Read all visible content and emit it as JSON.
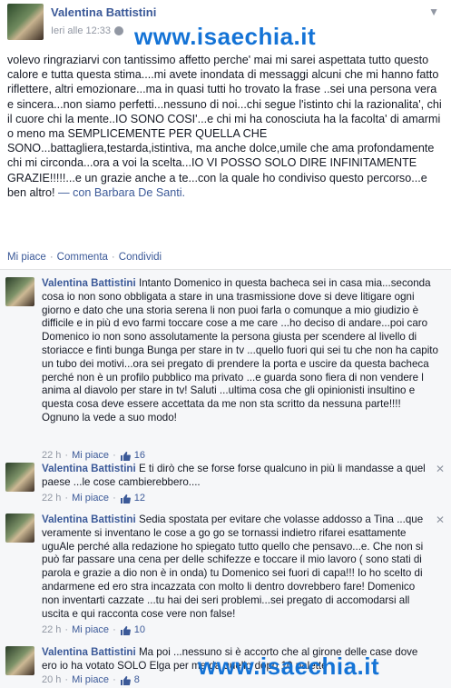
{
  "post": {
    "author": "Valentina Battistini",
    "timestamp": "Ieri alle 12:33",
    "body_main": "volevo ringraziarvi con tantissimo affetto perche' mai mi sarei aspettata tutto questo calore e tutta questa stima....mi avete inondata di messaggi alcuni che mi hanno fatto riflettere, altri emozionare...ma in quasi tutti ho trovato la frase ..sei una persona vera e sincera...non siamo perfetti...nessuno di noi...chi segue l'istinto chi la razionalita', chi il cuore chi la mente..IO SONO COSI'...e chi mi ha conosciuta ha la facolta' di amarmi o meno ma SEMPLICEMENTE PER QUELLA CHE SONO...battagliera,testarda,istintiva, ma anche dolce,umile che ama profondamente chi mi circonda...ora a voi la scelta...IO VI POSSO SOLO DIRE INFINITAMENTE GRAZIE!!!!!...e un grazie anche a te...con la quale ho condiviso questo percorso...e ben altro!",
    "body_with": "— con",
    "tagged": "Barbara De Santi.",
    "actions": {
      "like": "Mi piace",
      "comment": "Commenta",
      "share": "Condividi",
      "separator": "·"
    }
  },
  "watermark": "www.isaechia.it",
  "comments": [
    {
      "author": "Valentina Battistini",
      "text": "Intanto Domenico in questa bacheca sei in casa mia...seconda cosa io non sono obbligata a stare in una trasmissione dove si deve litigare ogni giorno e dato che una storia serena li non puoi farla o comunque a mio giudizio è difficile e in più d evo farmi toccare cose a me care ...ho deciso di andare...poi caro Domenico io non sono assolutamente la persona giusta per scendere al livello di storiacce e finti bunga Bunga per stare in tv ...quello fuori qui sei tu che non ha capito un tubo dei motivi...ora sei pregato di prendere la porta e uscire da questa bacheca perché non è un profilo pubblico ma privato ...e guarda sono fiera di non vendere l anima al diavolo per stare in tv! Saluti ...ultima cosa che gli opinionisti insultino e questa cosa deve essere accettata da me non sta scritto da nessuna parte!!!! Ognuno la vede a suo modo!",
      "time": "22 h",
      "like": "Mi piace",
      "likes": "16"
    },
    {
      "author": "Valentina Battistini",
      "text": "E ti dirò che se forse forse qualcuno in più li mandasse a quel paese ...le cose cambierebbero....",
      "time": "22 h",
      "like": "Mi piace",
      "likes": "12"
    },
    {
      "author": "Valentina Battistini",
      "text": "Sedia spostata per evitare che volasse addosso a Tina ...que veramente si inventano le cose a go go se tornassi indietro rifarei esattamente uguAle perché alla redazione ho spiegato tutto quello che pensavo...e. Che non si può far passare una cena per delle schifezze e toccare il mio lavoro ( sono stati di parola e grazie a dio non è in onda) tu Domenico sei fuori di capa!!! Io ho scelto di andarmene ed ero stra incazzata con molto li dentro dovrebbero fare! Domenico non inventarti cazzate ...tu hai dei seri problemi...sei pregato di accomodarsi all uscita e qui racconta cose vere non false!",
      "time": "22 h",
      "like": "Mi piace",
      "likes": "10"
    },
    {
      "author": "Valentina Battistini",
      "text": "Ma poi ...nessuno si è accorto che al girone delle case dove ero io ha votato SOLO Elga per me da quello dopo 10 palette",
      "time": "20 h",
      "like": "Mi piace",
      "likes": "8"
    }
  ],
  "colors": {
    "link": "#3b5998",
    "meta": "#9197a3",
    "watermark": "#1473d6",
    "comments_bg": "#f6f7f9"
  }
}
